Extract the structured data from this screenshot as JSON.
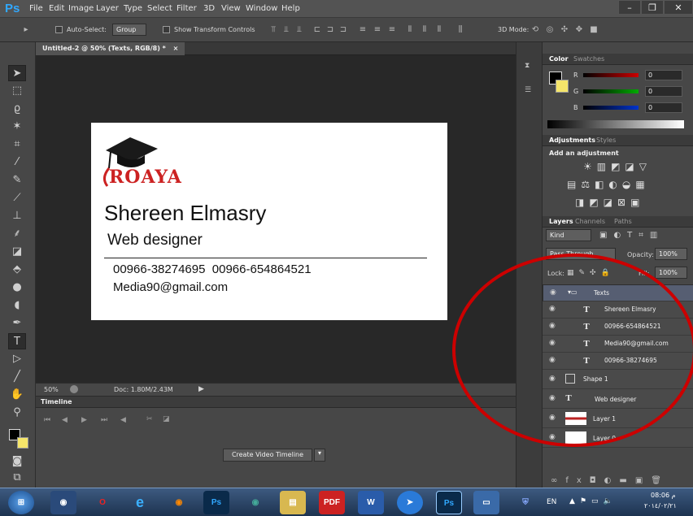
{
  "menubar": {
    "logo": "Ps",
    "items": [
      "File",
      "Edit",
      "Image",
      "Layer",
      "Type",
      "Select",
      "Filter",
      "3D",
      "View",
      "Window",
      "Help"
    ],
    "minimize": "–",
    "restore": "❐",
    "close": "✕"
  },
  "options": {
    "auto_select_label": "Auto-Select:",
    "auto_select_value": "Group",
    "show_transform": "Show Transform Controls",
    "mode_3d": "3D Mode:"
  },
  "document": {
    "tab_title": "Untitled-2 @ 50% (Texts, RGB/8) *",
    "tab_close": "×",
    "zoom": "50%",
    "doc_info": "Doc: 1.80M/2.43M"
  },
  "card": {
    "logo_text": "ROAYA",
    "name": "Shereen Elmasry",
    "title": "Web designer",
    "phones": "00966-38274695  00966-654864521",
    "email": "Media90@gmail.com"
  },
  "timeline": {
    "label": "Timeline",
    "create_button": "Create Video Timeline"
  },
  "color_panel": {
    "tabs": [
      "Color",
      "Swatches"
    ],
    "channels": [
      {
        "label": "R",
        "value": "0",
        "color": "#cc0000"
      },
      {
        "label": "G",
        "value": "0",
        "color": "#00aa00"
      },
      {
        "label": "B",
        "value": "0",
        "color": "#0033cc"
      }
    ]
  },
  "adjustments": {
    "tabs": [
      "Adjustments",
      "Styles"
    ],
    "heading": "Add an adjustment"
  },
  "layers_panel": {
    "tabs": [
      "Layers",
      "Channels",
      "Paths"
    ],
    "kind": "Kind",
    "blend": "Pass Through",
    "opacity_label": "Opacity:",
    "opacity": "100%",
    "lock_label": "Lock:",
    "fill_label": "Fill:",
    "fill": "100%",
    "layers": [
      {
        "name": "Texts",
        "type": "group",
        "selected": true
      },
      {
        "name": "Shereen Elmasry",
        "type": "text"
      },
      {
        "name": "00966-654864521",
        "type": "text"
      },
      {
        "name": "Media90@gmail.com",
        "type": "text"
      },
      {
        "name": "00966-38274695",
        "type": "text"
      },
      {
        "name": "Shape 1",
        "type": "shape"
      },
      {
        "name": "Web designer",
        "type": "text"
      },
      {
        "name": "Layer 1",
        "type": "image"
      },
      {
        "name": "Layer 0",
        "type": "white"
      }
    ]
  },
  "taskbar": {
    "lang": "EN",
    "time": "08:06 م",
    "date": "٢٠١٤/٠٢/٢١",
    "apps": [
      "start",
      "media",
      "opera",
      "ie",
      "firefox",
      "ps",
      "chrome",
      "explorer",
      "pdf",
      "word",
      "unknown",
      "ps2",
      "display",
      "shield"
    ]
  },
  "colors": {
    "accent": "#31a8ff",
    "annotation": "#cc0000",
    "logo_red": "#cc2222"
  }
}
